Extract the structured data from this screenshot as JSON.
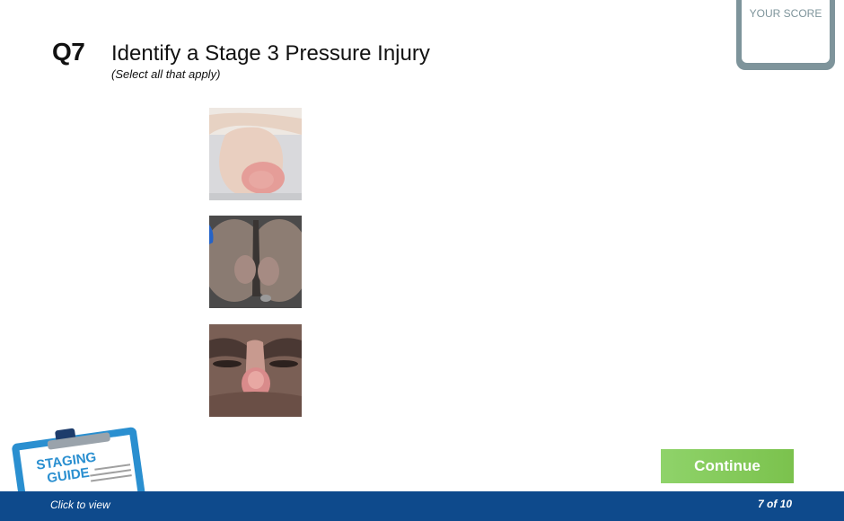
{
  "question": {
    "number": "Q7",
    "title": "Identify a Stage 3 Pressure Injury",
    "instruction": "(Select all that apply)"
  },
  "score": {
    "label": "YOUR SCORE"
  },
  "options": [
    {
      "icon": "heel-photo"
    },
    {
      "icon": "sacrum-photo"
    },
    {
      "icon": "nose-photo"
    }
  ],
  "staging_guide": {
    "title_line1": "STAGING",
    "title_line2": "GUIDE",
    "hint": "Click to view"
  },
  "continue_label": "Continue",
  "progress": "7 of 10",
  "colors": {
    "footer": "#0e4a8c",
    "continue": "#7bc24d",
    "score_frame": "#7e949b",
    "guide_blue": "#2a8fd0"
  }
}
